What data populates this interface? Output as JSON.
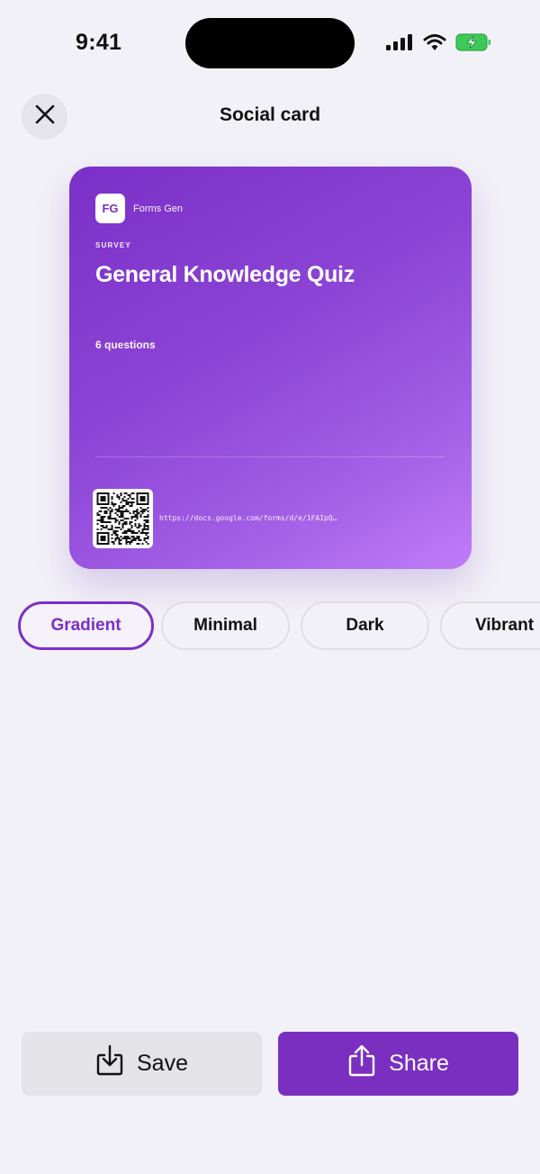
{
  "status_bar": {
    "time": "9:41"
  },
  "header": {
    "title": "Social card",
    "close_icon": "close-icon"
  },
  "card": {
    "brand_logo": "FG",
    "brand_name": "Forms Gen",
    "kicker": "SURVEY",
    "title": "General Knowledge Quiz",
    "meta": "6 questions",
    "url": "https://docs.google.com/forms/d/e/1FAIpQ…",
    "colors": {
      "gradient_start": "#7b2fc7",
      "gradient_end": "#c07cf7"
    }
  },
  "styles": {
    "selected": "Gradient",
    "options": [
      "Gradient",
      "Minimal",
      "Dark",
      "Vibrant"
    ]
  },
  "actions": {
    "save_label": "Save",
    "share_label": "Share"
  },
  "colors": {
    "accent": "#7b2fc0",
    "background": "#f2f1f7"
  }
}
